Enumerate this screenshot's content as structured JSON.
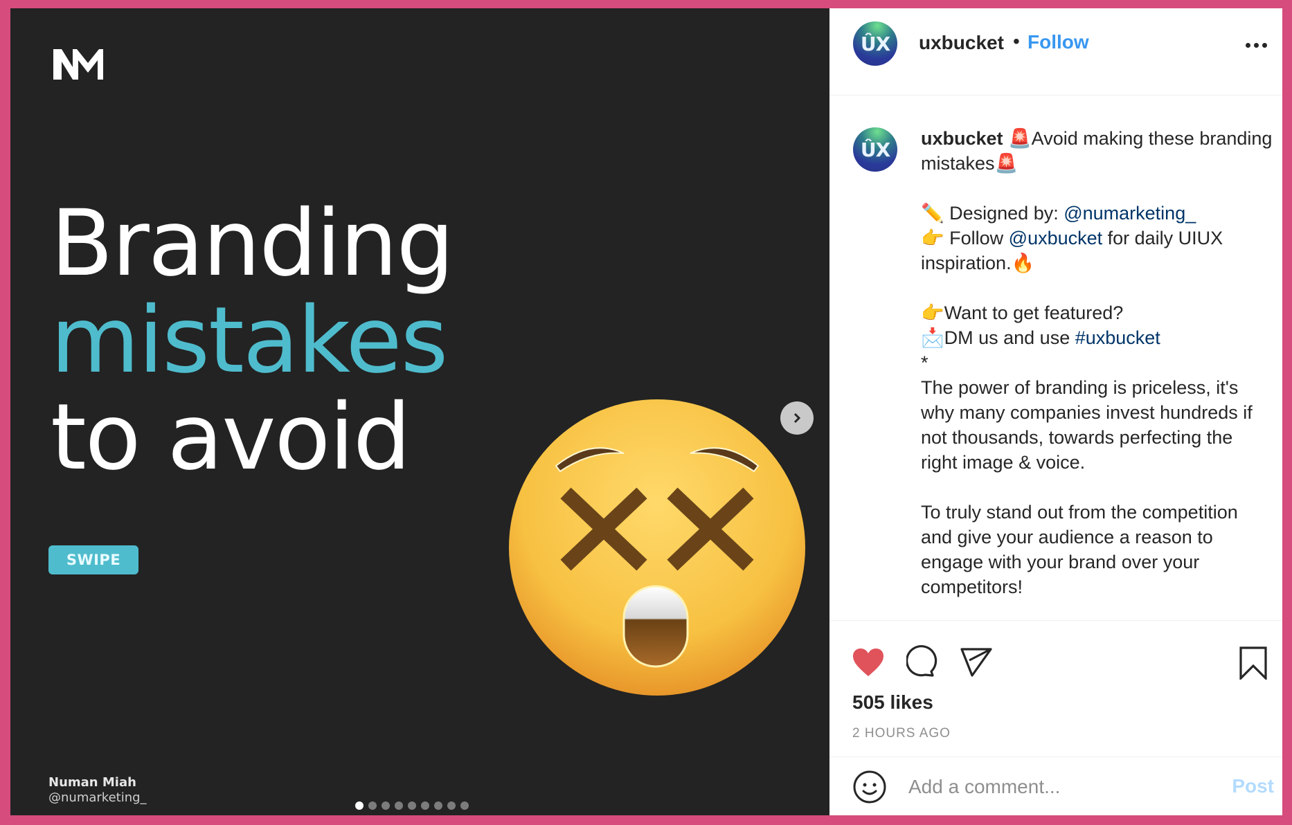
{
  "post_image": {
    "logo": "NM",
    "headline": {
      "line1": "Branding",
      "line2": "mistakes",
      "line3": "to avoid"
    },
    "swipe_label": "SWIPE",
    "credit_name": "Numan Miah",
    "credit_handle": "@numarketing_",
    "emoji": "dizzy-face",
    "carousel": {
      "total": 9,
      "current": 1
    },
    "colors": {
      "background": "#232323",
      "accent": "#4fbccd"
    }
  },
  "header": {
    "avatar_text": "ÛX",
    "username": "uxbucket",
    "separator": "•",
    "follow_label": "Follow"
  },
  "caption": {
    "avatar_text": "ÛX",
    "username": "uxbucket",
    "lines": {
      "l1": "🚨Avoid making these branding mistakes🚨",
      "l2_prefix": "✏️ Designed by: ",
      "l2_link": "@numarketing_",
      "l3_prefix": "👉 Follow ",
      "l3_link": "@uxbucket",
      "l3_suffix": " for daily UIUX inspiration.🔥",
      "l4": "👉Want to get featured?",
      "l5_prefix": "📩DM us and use ",
      "l5_link": "#uxbucket",
      "l6": "*",
      "p1": "The power of branding is priceless, it's why many companies invest hundreds if not thousands, towards perfecting the right image & voice.",
      "p2": "To truly stand out from the competition and give your audience a reason to engage with your brand over your competitors!"
    }
  },
  "actions": {
    "liked": true,
    "like_color": "#ed4956",
    "likes_text": "505 likes",
    "timestamp": "2 HOURS AGO"
  },
  "comment": {
    "placeholder": "Add a comment...",
    "value": "",
    "post_label": "Post"
  },
  "colors": {
    "frame": "#d64c7c",
    "link_blue": "#3897f0",
    "mention": "#003569"
  }
}
